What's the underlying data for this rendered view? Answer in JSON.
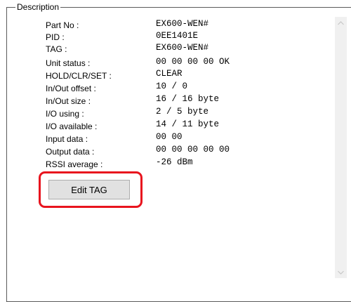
{
  "groupbox": {
    "title": "Description"
  },
  "fields": [
    {
      "label": "Part No :",
      "value": "EX600-WEN#"
    },
    {
      "label": "PID :",
      "value": "0EE1401E"
    },
    {
      "label": "TAG :",
      "value": "EX600-WEN#"
    },
    {
      "label": "Unit status :",
      "value": "00 00 00 00 OK"
    },
    {
      "label": "HOLD/CLR/SET :",
      "value": "CLEAR"
    },
    {
      "label": "In/Out offset :",
      "value": "10 / 0"
    },
    {
      "label": "In/Out size :",
      "value": "16 / 16 byte"
    },
    {
      "label": "I/O using :",
      "value": "2 / 5 byte"
    },
    {
      "label": "I/O available :",
      "value": "14 / 11 byte"
    },
    {
      "label": "Input data :",
      "value": "00 00"
    },
    {
      "label": "Output data :",
      "value": "00 00 00 00 00"
    },
    {
      "label": "RSSI average :",
      "value": "-26 dBm"
    }
  ],
  "edit_tag_button": {
    "label": "Edit TAG"
  },
  "colors": {
    "highlight": "#e8141e",
    "button_bg": "#e1e1e1",
    "scrollbar_bg": "#f0f0f0"
  }
}
